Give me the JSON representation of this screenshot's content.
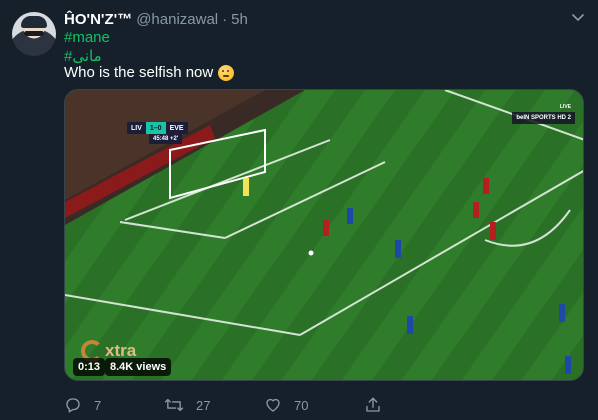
{
  "tweet": {
    "display_name": "ĤO'N'Z'™",
    "handle": "@hanizawal",
    "separator": "·",
    "time": "5h",
    "hashtags": [
      "#mane",
      "#مانى"
    ],
    "text": "Who is the selfish now"
  },
  "video": {
    "scorebug": {
      "home": "LIV",
      "score": "1–0",
      "away": "EVE",
      "clock": "45:48 +2'"
    },
    "broadcaster": "beIN SPORTS HD 2",
    "live_label": "LIVE",
    "watermark": "xtra",
    "duration": "0:13",
    "views": "8.4K views"
  },
  "actions": {
    "reply_count": "7",
    "retweet_count": "27",
    "like_count": "70"
  },
  "colors": {
    "background": "#15202b",
    "secondary_text": "#8899a6",
    "hashtag": "#17bf63",
    "border": "#38444d",
    "pitch": "#2f7a2a"
  },
  "icons": {
    "caret": "chevron-down-icon",
    "reply": "reply-icon",
    "retweet": "retweet-icon",
    "like": "heart-icon",
    "share": "share-icon"
  }
}
